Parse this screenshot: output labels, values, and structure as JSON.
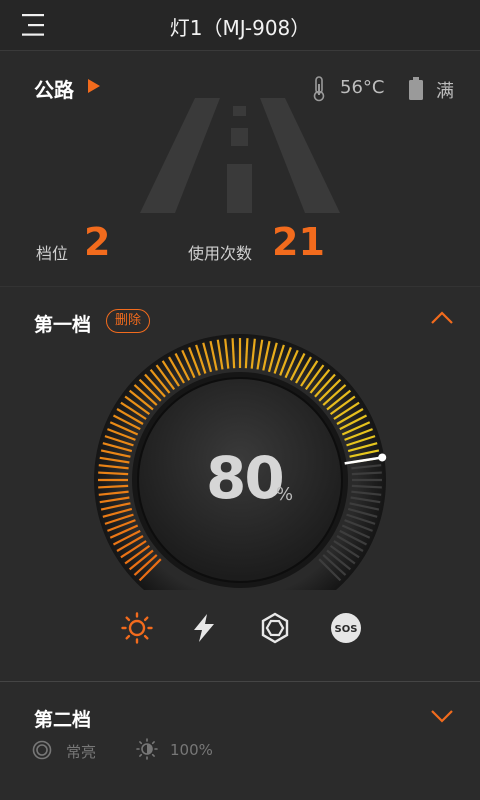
{
  "header": {
    "title": "灯1（MJ-908）",
    "menu_icon": "menu-icon"
  },
  "status": {
    "mode_label": "公路",
    "temperature": "56°C",
    "battery": "满",
    "gear_label": "档位",
    "gear_value": "2",
    "uses_label": "使用次数",
    "uses_value": "21"
  },
  "gear1": {
    "title": "第一档",
    "delete_label": "删除",
    "brightness_value": "80",
    "brightness_unit": "%",
    "brightness_fraction": 0.8,
    "modes": [
      "sun-icon",
      "flash-icon",
      "strobe-icon",
      "sos-icon"
    ],
    "sos_label": "SOS",
    "selected_mode": "sun-icon"
  },
  "gear2": {
    "title": "第二档",
    "mode_text": "常亮",
    "brightness_text": "100%"
  },
  "colors": {
    "accent": "#f26b1d",
    "background": "#2b2b2b"
  }
}
